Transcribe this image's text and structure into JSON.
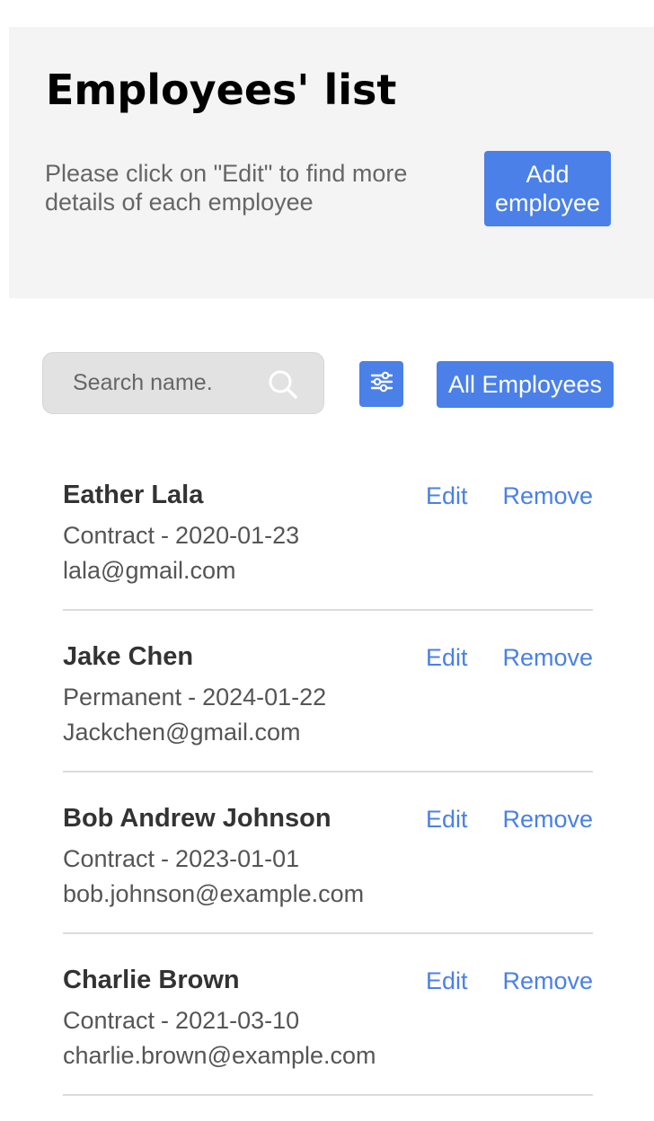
{
  "header": {
    "title": "Employees' list",
    "subtitle": "Please click on \"Edit\" to find more details of each employee",
    "add_button_label": "Add employee"
  },
  "toolbar": {
    "search_placeholder": "Search name.",
    "search_value": "",
    "search_icon": "search-icon",
    "filter_icon": "sliders-icon",
    "all_employees_label": "All Employees"
  },
  "colors": {
    "accent": "#4a80e8",
    "header_background": "#f4f4f4",
    "search_background": "#e2e2e2",
    "divider": "#dcdcdc"
  },
  "employees": [
    {
      "name": "Eather Lala",
      "type": "Contract",
      "date": "2020-01-23",
      "email": "lala@gmail.com",
      "edit_label": "Edit",
      "remove_label": "Remove"
    },
    {
      "name": "Jake Chen",
      "type": "Permanent",
      "date": "2024-01-22",
      "email": "Jackchen@gmail.com",
      "edit_label": "Edit",
      "remove_label": "Remove"
    },
    {
      "name": "Bob Andrew Johnson",
      "type": "Contract",
      "date": "2023-01-01",
      "email": "bob.johnson@example.com",
      "edit_label": "Edit",
      "remove_label": "Remove"
    },
    {
      "name": "Charlie Brown",
      "type": "Contract",
      "date": "2021-03-10",
      "email": "charlie.brown@example.com",
      "edit_label": "Edit",
      "remove_label": "Remove"
    }
  ]
}
